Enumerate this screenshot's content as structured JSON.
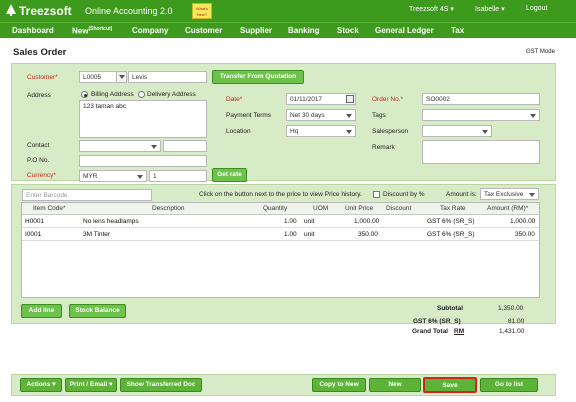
{
  "brand": {
    "name": "Treezsoft",
    "tagline": "Online Accounting 2.0",
    "badge": "What's New?"
  },
  "topmenu": {
    "company": "Treezsoft 4S",
    "user": "Isabelle",
    "logout": "Logout"
  },
  "nav": [
    {
      "label": "Dashboard"
    },
    {
      "label": "New",
      "sup": "(Shortcut)"
    },
    {
      "label": "Company"
    },
    {
      "label": "Customer"
    },
    {
      "label": "Supplier"
    },
    {
      "label": "Banking"
    },
    {
      "label": "Stock"
    },
    {
      "label": "General Ledger"
    },
    {
      "label": "Tax"
    }
  ],
  "page": {
    "title": "Sales Order",
    "gst_mode": "GST Mode"
  },
  "customer": {
    "label": "Customer*",
    "code": "L0005",
    "name": "Levis",
    "transfer_btn": "Transfer From Quotation"
  },
  "address": {
    "label": "Address",
    "billing": "Billing Address",
    "delivery": "Delivery Address",
    "value": "123 taman abc"
  },
  "contact": {
    "label": "Contact"
  },
  "po": {
    "label": "P.O No."
  },
  "currency": {
    "label": "Currency*",
    "code": "MYR",
    "rate": "1",
    "get_rate": "Get rate"
  },
  "date": {
    "label": "Date*",
    "value": "01/11/2017"
  },
  "payment_terms": {
    "label": "Payment Terms",
    "value": "Net 30 days"
  },
  "location": {
    "label": "Location",
    "value": "Hq"
  },
  "order_no": {
    "label": "Order No.*",
    "value": "SO0002"
  },
  "tags": {
    "label": "Tags"
  },
  "salesperson": {
    "label": "Salesperson"
  },
  "remark": {
    "label": "Remark"
  },
  "barcode": {
    "placeholder": "Enter Barcode",
    "hint": "Click on the button next to the price to view Price history.",
    "discount_pct": "Discount by %",
    "amount_is": "Amount is:",
    "amount_mode": "Tax Exclusive"
  },
  "table": {
    "headers": [
      "Item Code*",
      "Description",
      "Quantity",
      "UOM",
      "Unit Price",
      "Discount",
      "Tax Rate",
      "Amount (RM)*"
    ],
    "rows": [
      {
        "code": "H0001",
        "desc": "No lens headlamps",
        "qty": "1.00",
        "uom": "unit",
        "price": "1,000.00",
        "disc": "",
        "tax": "GST 6% (SR_S)",
        "amount": "1,000.00"
      },
      {
        "code": "I0001",
        "desc": "3M Tinter",
        "qty": "1.00",
        "uom": "unit",
        "price": "350.00",
        "disc": "",
        "tax": "GST 6% (SR_S)",
        "amount": "350.00"
      }
    ]
  },
  "line_buttons": {
    "add_line": "Add line",
    "stock_balance": "Stock Balance"
  },
  "totals": {
    "subtotal_label": "Subtotal",
    "subtotal": "1,350.00",
    "gst_label": "GST 6% (SR_S)",
    "gst": "81.00",
    "grand_label": "Grand Total",
    "grand_cur": "RM",
    "grand": "1,431.00"
  },
  "footer": {
    "actions": "Actions",
    "print": "Print / Email",
    "show_transferred": "Show Transferred Doc",
    "copy_new": "Copy to New",
    "new": "New",
    "save": "Save",
    "go_list": "Go to list"
  },
  "colors": {
    "brand_green": "#3d9a1c",
    "panel_green": "#d8ebc7",
    "required_red": "#c0271a",
    "save_outline": "#d0261c"
  }
}
